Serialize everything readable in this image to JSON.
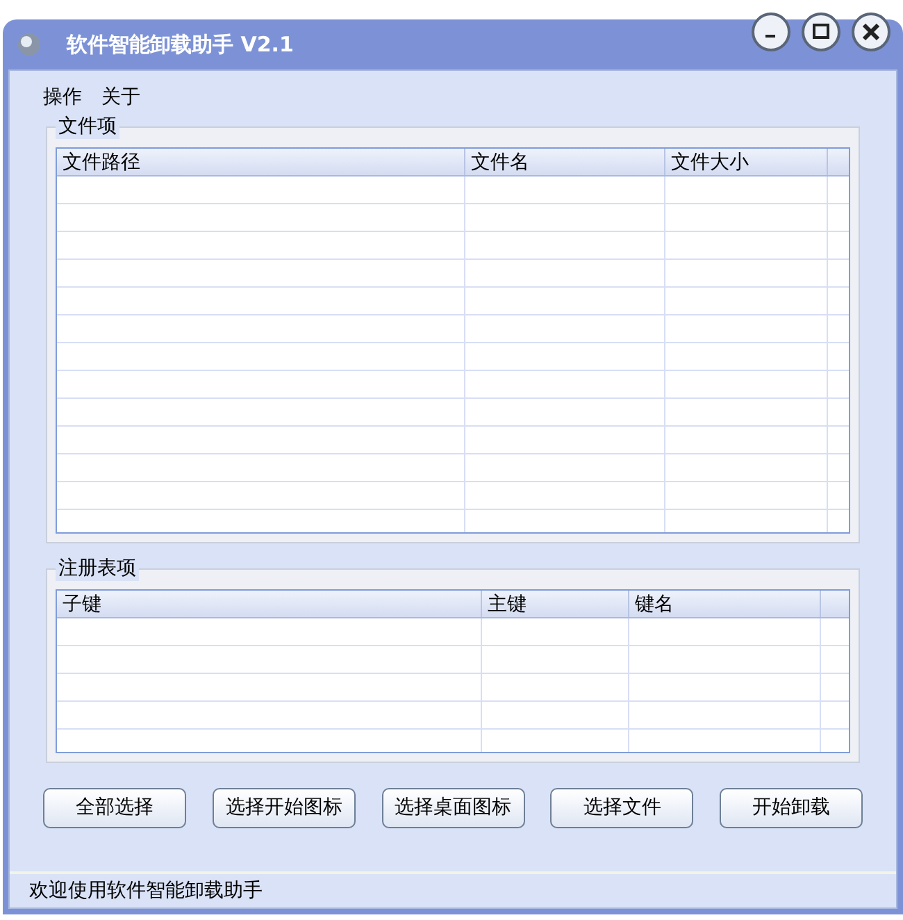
{
  "window": {
    "title": "软件智能卸载助手 V2.1"
  },
  "menu": [
    "操作",
    "关于"
  ],
  "file_group": {
    "title": "文件项",
    "columns": [
      "文件路径",
      "文件名",
      "文件大小"
    ]
  },
  "registry_group": {
    "title": "注册表项",
    "columns": [
      "子键",
      "主键",
      "键名"
    ]
  },
  "buttons": [
    "全部选择",
    "选择开始图标",
    "选择桌面图标",
    "选择文件",
    "开始卸载"
  ],
  "status_bar": "欢迎使用软件智能卸载助手"
}
